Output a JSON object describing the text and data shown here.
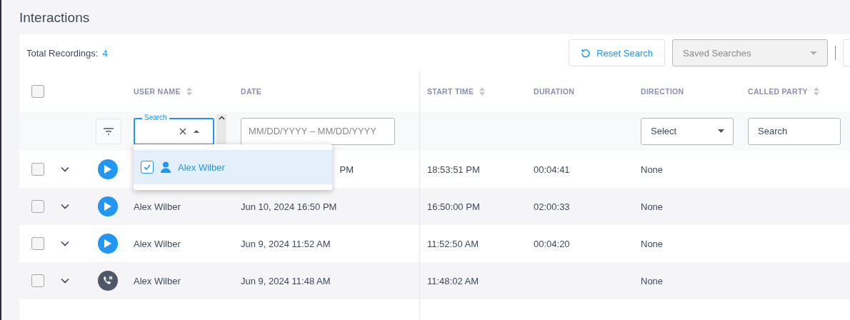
{
  "page": {
    "title": "Interactions"
  },
  "toolbar": {
    "total_label": "Total Recordings:",
    "total_count": "4",
    "reset_button": "Reset Search",
    "saved_searches": {
      "placeholder": "Saved Searches",
      "disabled": true
    }
  },
  "table": {
    "columns": [
      {
        "label": "USER NAME",
        "sortable": true
      },
      {
        "label": "DATE",
        "sortable": false
      },
      {
        "label": "START TIME",
        "sortable": true
      },
      {
        "label": "DURATION",
        "sortable": false
      },
      {
        "label": "DIRECTION",
        "sortable": false
      },
      {
        "label": "CALLED PARTY",
        "sortable": true
      }
    ],
    "select_all": {
      "checked": false
    },
    "filters": {
      "user_name": {
        "label": "Search"
      },
      "date": {
        "placeholder": "MM/DD/YYYY – MM/DD/YYYY"
      },
      "direction": {
        "value": "Select"
      },
      "called_party": {
        "placeholder": "Search"
      }
    },
    "user_dropdown": {
      "options": [
        {
          "label": "Alex Wilber",
          "checked": true,
          "selected": true
        }
      ]
    },
    "rows": [
      {
        "kind": "recording",
        "checked": false,
        "date": "PM",
        "start_time": "18:53:51 PM",
        "duration": "00:04:41",
        "direction": "None"
      },
      {
        "kind": "recording",
        "checked": false,
        "user_name": "Alex Wilber",
        "date": "Jun 10, 2024 16:50 PM",
        "start_time": "16:50:00 PM",
        "duration": "02:00:33",
        "direction": "None"
      },
      {
        "kind": "recording",
        "checked": false,
        "user_name": "Alex Wilber",
        "date": "Jun 9, 2024 11:52 AM",
        "start_time": "11:52:50 AM",
        "duration": "00:04:20",
        "direction": "None"
      },
      {
        "kind": "missed",
        "checked": false,
        "user_name": "Alex Wilber",
        "date": "Jun 9, 2024 11:48 AM",
        "start_time": "11:48:02 AM",
        "direction": "None"
      }
    ]
  }
}
